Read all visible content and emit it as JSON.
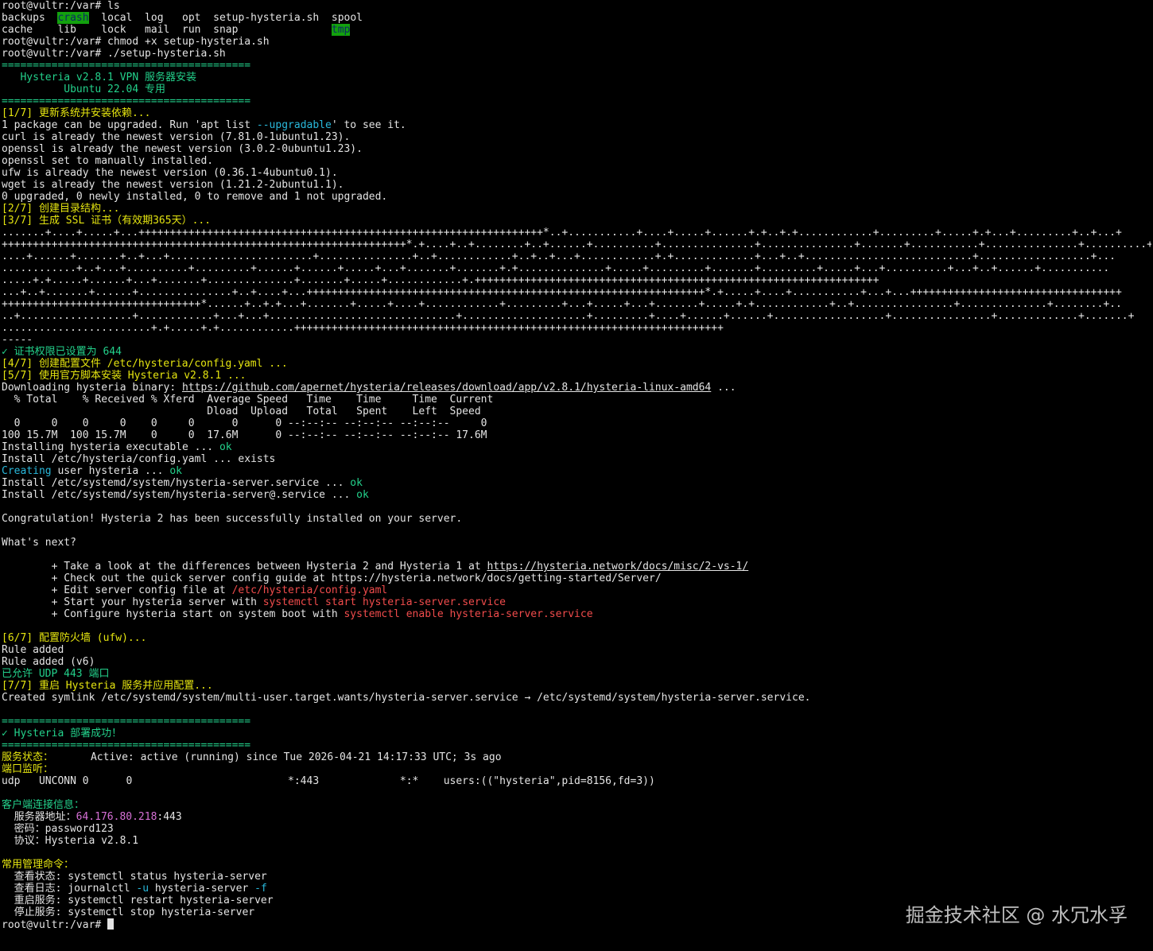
{
  "colors": {
    "background": "#000000",
    "default": "#e4e4e4",
    "blue": "#3b8eea",
    "cyan": "#29b8db",
    "green": "#23d18b",
    "yellow": "#e5e510",
    "red": "#f14c4c",
    "magenta": "#d670d6",
    "highlight_bg": "#13a10e"
  },
  "watermark": "掘金技术社区 @ 水冗水孚",
  "terminal": {
    "lines": [
      [
        [
          "root@vultr:/var# ls",
          "white"
        ]
      ],
      [
        [
          "backups",
          "blue"
        ],
        [
          "  ",
          "white"
        ],
        [
          "crash",
          "hl"
        ],
        [
          "  ",
          "white"
        ],
        [
          "local",
          "blue"
        ],
        [
          "  ",
          "white"
        ],
        [
          "log",
          "blue"
        ],
        [
          "   ",
          "white"
        ],
        [
          "opt",
          "blue"
        ],
        [
          "  ",
          "white"
        ],
        [
          "setup-hysteria.sh",
          "white"
        ],
        [
          "  ",
          "white"
        ],
        [
          "spool",
          "blue"
        ]
      ],
      [
        [
          "cache",
          "blue"
        ],
        [
          "    ",
          "white"
        ],
        [
          "lib",
          "blue"
        ],
        [
          "    ",
          "white"
        ],
        [
          "lock",
          "white"
        ],
        [
          "   ",
          "white"
        ],
        [
          "mail",
          "blue"
        ],
        [
          "  ",
          "white"
        ],
        [
          "run",
          "white"
        ],
        [
          "  ",
          "white"
        ],
        [
          "snap",
          "blue"
        ],
        [
          "               ",
          "white"
        ],
        [
          "tmp",
          "hl"
        ]
      ],
      [
        [
          "root@vultr:/var# chmod +x setup-hysteria.sh",
          "white"
        ]
      ],
      [
        [
          "root@vultr:/var# ./setup-hysteria.sh",
          "white"
        ]
      ],
      [
        [
          "========================================",
          "green"
        ]
      ],
      [
        [
          "   Hysteria v2.8.1 VPN 服务器安装",
          "green"
        ]
      ],
      [
        [
          "          Ubuntu 22.04 专用",
          "green"
        ]
      ],
      [
        [
          "========================================",
          "green"
        ]
      ],
      [
        [
          "[1/7] 更新系统并安装依赖...",
          "yellow"
        ]
      ],
      [
        [
          "1 package can be upgraded. Run 'apt list ",
          "white"
        ],
        [
          "--upgradable",
          "cyan"
        ],
        [
          "' to see it.",
          "white"
        ]
      ],
      [
        [
          "curl is already the newest version (7.81.0-1ubuntu1.23).",
          "white"
        ]
      ],
      [
        [
          "openssl is already the newest version (3.0.2-0ubuntu1.23).",
          "white"
        ]
      ],
      [
        [
          "openssl set to manually installed.",
          "white"
        ]
      ],
      [
        [
          "ufw is already the newest version (0.36.1-4ubuntu0.1).",
          "white"
        ]
      ],
      [
        [
          "wget is already the newest version (1.21.2-2ubuntu1.1).",
          "white"
        ]
      ],
      [
        [
          "0 upgraded, 0 newly installed, 0 to remove and 1 not upgraded.",
          "white"
        ]
      ],
      [
        [
          "[2/7] 创建目录结构...",
          "yellow"
        ]
      ],
      [
        [
          "[3/7] 生成 SSL 证书（有效期365天）...",
          "yellow"
        ]
      ],
      [
        [
          ".......+....+.....+...+++++++++++++++++++++++++++++++++++++++++++++++++++++++++++++++++*..+...........+....+.....+......+.+..+.+............+.........+.....+.+...+.........+..+...+",
          "white"
        ]
      ],
      [
        [
          "+++++++++++++++++++++++++++++++++++++++++++++++++++++++++++++++++*.+....+..+........+..+......+..........+...............+...............+.......+...........+...............+..........+.",
          "white"
        ]
      ],
      [
        [
          "....+......+.......+..+...+.......................+...............+..+............+..+..+...+............+.+.............+...+..+...........................+..................+...",
          "white"
        ]
      ],
      [
        [
          "............+..+...+..........+.........+......+......+.....+...+.......+.......+.+..............+.....+.........+.......+.........+.....+...+..........+...+..+......+...........",
          "white"
        ]
      ],
      [
        [
          ".....+.+.....+......+...+.......+..............+.......+.....+............+.+++++++++++++++++++++++++++++++++++++++++++++++++++++++++++++++++",
          "white"
        ]
      ],
      [
        [
          "...+..+.......+......+...............+..+....+...++++++++++++++++++++++++++++++++++++++++++++++++++++++++++++++++*.+.....+....+...........+...+...++++++++++++++++++++++++++++++++++",
          "white"
        ]
      ],
      [
        [
          "++++++++++++++++++++++++++++++++*......+..+.+...+.......+.....+....+............+.........+...+.....+...+.......+.....+.+............+..+................+..............+........+..",
          "white"
        ]
      ],
      [
        [
          "..+..................+............+...+...+..............................+....................+.........+....+......+......+..................+................+.............+.......+",
          "white"
        ]
      ],
      [
        [
          "........................+.+.....+.+............+++++++++++++++++++++++++++++++++++++++++++++++++++++++++++++++++++++",
          "white"
        ]
      ],
      [
        [
          "-----",
          "white"
        ]
      ],
      [
        [
          "✓ 证书权限已设置为 644",
          "green"
        ]
      ],
      [
        [
          "[4/7] 创建配置文件 /etc/hysteria/config.yaml ...",
          "yellow"
        ]
      ],
      [
        [
          "[5/7] 使用官方脚本安装 Hysteria v2.8.1 ...",
          "yellow"
        ]
      ],
      [
        [
          "Downloading hysteria binary: ",
          "white"
        ],
        [
          "https://github.com/apernet/hysteria/releases/download/app/v2.8.1/hysteria-linux-amd64",
          "white u"
        ],
        [
          " ...",
          "white"
        ]
      ],
      [
        [
          "  % Total    % Received % Xferd  Average Speed   Time    Time     Time  Current",
          "white"
        ]
      ],
      [
        [
          "                                 Dload  Upload   Total   Spent    Left  Speed",
          "white"
        ]
      ],
      [
        [
          "  0     0    0     0    0     0      0      0 --:--:-- --:--:-- --:--:--     0",
          "white"
        ]
      ],
      [
        [
          "100 15.7M  100 15.7M    0     0  17.6M      0 --:--:-- --:--:-- --:--:-- 17.6M",
          "white"
        ]
      ],
      [
        [
          "Installing hysteria executable ... ",
          "white"
        ],
        [
          "ok",
          "green"
        ]
      ],
      [
        [
          "Install /etc/hysteria/config.yaml ... exists",
          "white"
        ]
      ],
      [
        [
          "Creating",
          "cyan"
        ],
        [
          " user hysteria ... ",
          "white"
        ],
        [
          "ok",
          "green"
        ]
      ],
      [
        [
          "Install /etc/systemd/system/hysteria-server.service ... ",
          "white"
        ],
        [
          "ok",
          "green"
        ]
      ],
      [
        [
          "Install /etc/systemd/system/hysteria-server@.service ... ",
          "white"
        ],
        [
          "ok",
          "green"
        ]
      ],
      [
        [
          "",
          "white"
        ]
      ],
      [
        [
          "Congratulation! Hysteria 2 has been successfully installed on your server.",
          "white"
        ]
      ],
      [
        [
          "",
          "white"
        ]
      ],
      [
        [
          "What's next?",
          "white"
        ]
      ],
      [
        [
          "",
          "white"
        ]
      ],
      [
        [
          "        + Take a look at the differences between Hysteria 2 and Hysteria 1 at ",
          "white"
        ],
        [
          "https://hysteria.network/docs/misc/2-vs-1/",
          "white u"
        ]
      ],
      [
        [
          "        + Check out the quick server config guide at ",
          "white"
        ],
        [
          "https://hysteria.network/docs/getting-started/Server/",
          "blue"
        ]
      ],
      [
        [
          "        + Edit server config file at ",
          "white"
        ],
        [
          "/etc/hysteria/config.yaml",
          "red"
        ]
      ],
      [
        [
          "        + Start your hysteria server with ",
          "white"
        ],
        [
          "systemctl start hysteria-server.service",
          "red"
        ]
      ],
      [
        [
          "        + Configure hysteria start on system boot with ",
          "white"
        ],
        [
          "systemctl enable hysteria-server.service",
          "red"
        ]
      ],
      [
        [
          "",
          "white"
        ]
      ],
      [
        [
          "[6/7] 配置防火墙 (ufw)...",
          "yellow"
        ]
      ],
      [
        [
          "Rule added",
          "white"
        ]
      ],
      [
        [
          "Rule added (v6)",
          "white"
        ]
      ],
      [
        [
          "已允许 UDP 443 端口",
          "green"
        ]
      ],
      [
        [
          "[7/7] 重启 Hysteria 服务并应用配置...",
          "yellow"
        ]
      ],
      [
        [
          "Created symlink /etc/systemd/system/multi-user.target.wants/hysteria-server.service → /etc/systemd/system/hysteria-server.service.",
          "white"
        ]
      ],
      [
        [
          "",
          "white"
        ]
      ],
      [
        [
          "========================================",
          "green"
        ]
      ],
      [
        [
          "✓ Hysteria 部署成功！",
          "green"
        ]
      ],
      [
        [
          "========================================",
          "green"
        ]
      ],
      [
        [
          "服务状态：",
          "yellow"
        ],
        [
          "      Active: active (running) since Tue 2026-04-21 14:17:33 UTC; 3s ago",
          "white"
        ]
      ],
      [
        [
          "端口监听：",
          "yellow"
        ]
      ],
      [
        [
          "udp   UNCONN 0      0                         *:443             *:*    users:((\"hysteria\",pid=8156,fd=3))",
          "white"
        ]
      ],
      [
        [
          "",
          "white"
        ]
      ],
      [
        [
          "客户端连接信息：",
          "green"
        ]
      ],
      [
        [
          "  服务器地址：",
          "white"
        ],
        [
          "64.176.80.218",
          "magenta"
        ],
        [
          ":443",
          "white"
        ]
      ],
      [
        [
          "  密码：password123",
          "white"
        ]
      ],
      [
        [
          "  协议：Hysteria v2.8.1",
          "white"
        ]
      ],
      [
        [
          "",
          "white"
        ]
      ],
      [
        [
          "常用管理命令：",
          "yellow"
        ]
      ],
      [
        [
          "  查看状态: systemctl status hysteria-server",
          "white"
        ]
      ],
      [
        [
          "  查看日志: journalctl ",
          "white"
        ],
        [
          "-u",
          "cyan"
        ],
        [
          " hysteria-server ",
          "white"
        ],
        [
          "-f",
          "cyan"
        ]
      ],
      [
        [
          "  重启服务: systemctl restart hysteria-server",
          "white"
        ]
      ],
      [
        [
          "  停止服务: systemctl stop hysteria-server",
          "white"
        ]
      ],
      [
        [
          "root@vultr:/var# ",
          "white"
        ]
      ]
    ]
  }
}
